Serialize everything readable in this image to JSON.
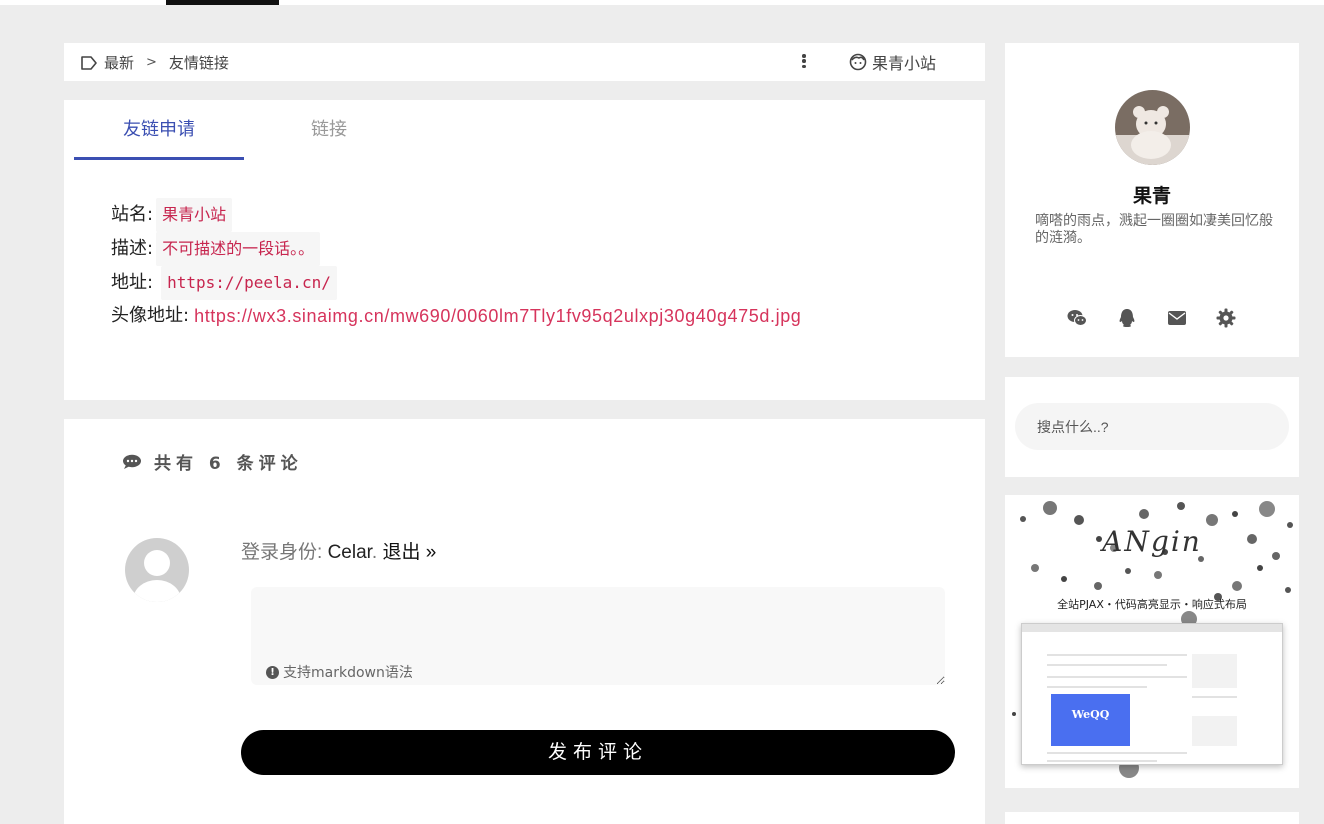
{
  "breadcrumb": {
    "home": "最新",
    "current": "友情链接"
  },
  "site_link": "果青小站",
  "tabs": [
    {
      "label": "友链申请"
    },
    {
      "label": "链接"
    }
  ],
  "info": {
    "name_label": "站名:",
    "name_value": "果青小站",
    "desc_label": "描述:",
    "desc_value": "不可描述的一段话。。",
    "url_label": "地址:",
    "url_value": "https://peela.cn/",
    "avatar_label": "头像地址:",
    "avatar_value": "https://wx3.sinaimg.cn/mw690/0060lm7Tly1fv95q2ulxpj30g40g475d.jpg"
  },
  "comments": {
    "title": "共有 6 条评论",
    "login_prefix": "登录身份: ",
    "user": "Celar",
    "logout": "退出 »",
    "markdown_note": "支持markdown语法",
    "submit": "发布评论"
  },
  "profile": {
    "name": "果青",
    "description": "嘀嗒的雨点，溅起一圈圈如凄美回忆般的涟漪。"
  },
  "social_icons": [
    "wechat-icon",
    "qq-icon",
    "mail-icon",
    "gear-icon"
  ],
  "search": {
    "placeholder": "搜点什么..?"
  },
  "banner": {
    "title": "ANgin",
    "subtitle": "全站PJAX・代码高亮显示・响应式布局",
    "mini_label": "WeQQ"
  },
  "colors": {
    "accent": "#3b4fb2",
    "code": "#c7254e",
    "link": "#d6345c",
    "button": "#000000"
  }
}
